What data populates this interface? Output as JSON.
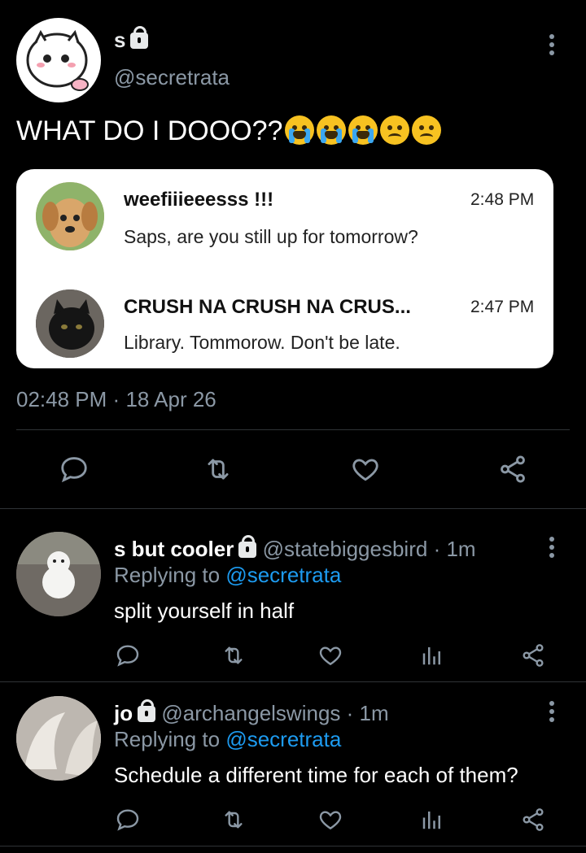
{
  "tweet": {
    "display_name": "s",
    "handle": "@secretrata",
    "text": "WHAT DO I DOOO??",
    "emojis": [
      "loudly-crying-face",
      "loudly-crying-face",
      "loudly-crying-face",
      "confused-face",
      "confused-face"
    ],
    "timestamp": "02:48 PM",
    "separator": "·",
    "date": "18 Apr 26"
  },
  "card": {
    "messages": [
      {
        "name": "weefiiieeesss !!!",
        "time": "2:48 PM",
        "text": "Saps, are you still up for tomorrow?",
        "avatar": "puppy-avatar"
      },
      {
        "name": "CRUSH NA CRUSH NA CRUS...",
        "time": "2:47 PM",
        "text": "Library. Tommorow. Don't be late.",
        "avatar": "black-cat-avatar"
      }
    ]
  },
  "actions": [
    "reply-icon",
    "retweet-icon",
    "like-icon",
    "share-icon"
  ],
  "replies": [
    {
      "name": "s but cooler",
      "handle": "@statebiggesbird",
      "age": "· 1m",
      "replying_prefix": "Replying to",
      "replying_to": "@secretrata",
      "text": "split yourself in half"
    },
    {
      "name": "jo",
      "handle": "@archangelswings",
      "age": "· 1m",
      "replying_prefix": "Replying to",
      "replying_to": "@secretrata",
      "text": "Schedule a different time for each of them?"
    }
  ],
  "colors": {
    "background": "#000000",
    "link": "#1d9bf0",
    "muted": "#8b98a5"
  }
}
